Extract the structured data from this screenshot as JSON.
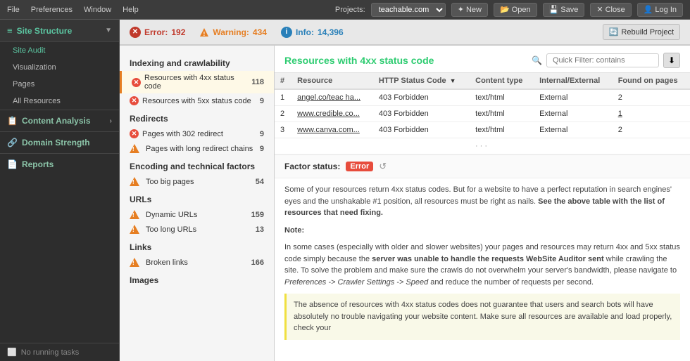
{
  "titlebar": {
    "menu": [
      "File",
      "Preferences",
      "Window",
      "Help"
    ],
    "projects_label": "Projects:",
    "projects_value": "teachable.com",
    "buttons": [
      "New",
      "Open",
      "Save",
      "Close",
      "Log In"
    ]
  },
  "stats_bar": {
    "error_label": "Error:",
    "error_count": "192",
    "warning_label": "Warning:",
    "warning_count": "434",
    "info_label": "Info:",
    "info_count": "14,396",
    "rebuild_label": "Rebuild Project"
  },
  "sidebar": {
    "section_title": "Site Structure",
    "items": [
      {
        "label": "Site Audit",
        "active": true
      },
      {
        "label": "Visualization",
        "active": false
      },
      {
        "label": "Pages",
        "active": false
      },
      {
        "label": "All Resources",
        "active": false
      }
    ],
    "sections": [
      {
        "label": "Content Analysis",
        "icon": "📋"
      },
      {
        "label": "Domain Strength",
        "icon": "🔗"
      },
      {
        "label": "Reports",
        "icon": "📄"
      }
    ],
    "bottom_label": "No running tasks"
  },
  "issues": {
    "sections": [
      {
        "title": "Indexing and crawlability",
        "items": [
          {
            "type": "error",
            "text": "Resources with 4xx status code",
            "count": "118",
            "selected": true
          },
          {
            "type": "error",
            "text": "Resources with 5xx status code",
            "count": "9",
            "selected": false
          }
        ]
      },
      {
        "title": "Redirects",
        "items": [
          {
            "type": "error",
            "text": "Pages with 302 redirect",
            "count": "9",
            "selected": false
          },
          {
            "type": "warning",
            "text": "Pages with long redirect chains",
            "count": "9",
            "selected": false
          }
        ]
      },
      {
        "title": "Encoding and technical factors",
        "items": [
          {
            "type": "warning",
            "text": "Too big pages",
            "count": "54",
            "selected": false
          }
        ]
      },
      {
        "title": "URLs",
        "items": [
          {
            "type": "warning",
            "text": "Dynamic URLs",
            "count": "159",
            "selected": false
          },
          {
            "type": "warning",
            "text": "Too long URLs",
            "count": "13",
            "selected": false
          }
        ]
      },
      {
        "title": "Links",
        "items": [
          {
            "type": "warning",
            "text": "Broken links",
            "count": "166",
            "selected": false
          }
        ]
      },
      {
        "title": "Images",
        "items": []
      }
    ]
  },
  "detail": {
    "title": "Resources with 4xx status code",
    "filter_placeholder": "Quick Filter: contains",
    "table": {
      "columns": [
        "#",
        "Resource",
        "HTTP Status Code",
        "Content type",
        "Internal/External",
        "Found on pages"
      ],
      "rows": [
        {
          "num": "1",
          "resource": "angel.co/teac ha...",
          "http_status": "403 Forbidden",
          "content_type": "text/html",
          "internal_external": "External",
          "found_on": "2"
        },
        {
          "num": "2",
          "resource": "www.credible.co...",
          "http_status": "403 Forbidden",
          "content_type": "text/html",
          "internal_external": "External",
          "found_on": "1"
        },
        {
          "num": "3",
          "resource": "www.canva.com...",
          "http_status": "403 Forbidden",
          "content_type": "text/html",
          "internal_external": "External",
          "found_on": "2"
        }
      ]
    },
    "factor_status_label": "Factor status:",
    "factor_status_value": "Error",
    "description": "Some of your resources return 4xx status codes. But for a website to have a perfect reputation in search engines' eyes and the unshakable #1 position, all resources must be right as nails.",
    "description_bold": "See the above table with the list of resources that need fixing.",
    "note_title": "Note:",
    "note_text": "In some cases (especially with older and slower websites) your pages and resources may return 4xx and 5xx status code simply because the",
    "note_bold": "server was unable to handle the requests WebSite Auditor sent",
    "note_text2": "while crawling the site. To solve the problem and make sure the crawls do not overwhelm your server's bandwidth, please navigate to",
    "note_italic": "Preferences -> Crawler Settings -> Speed",
    "note_text3": "and reduce the number of requests per second.",
    "highlight_text": "The absence of resources with 4xx status codes does not guarantee that users and search bots will have absolutely no trouble navigating your website content. Make sure all resources are available and load properly, check your"
  }
}
